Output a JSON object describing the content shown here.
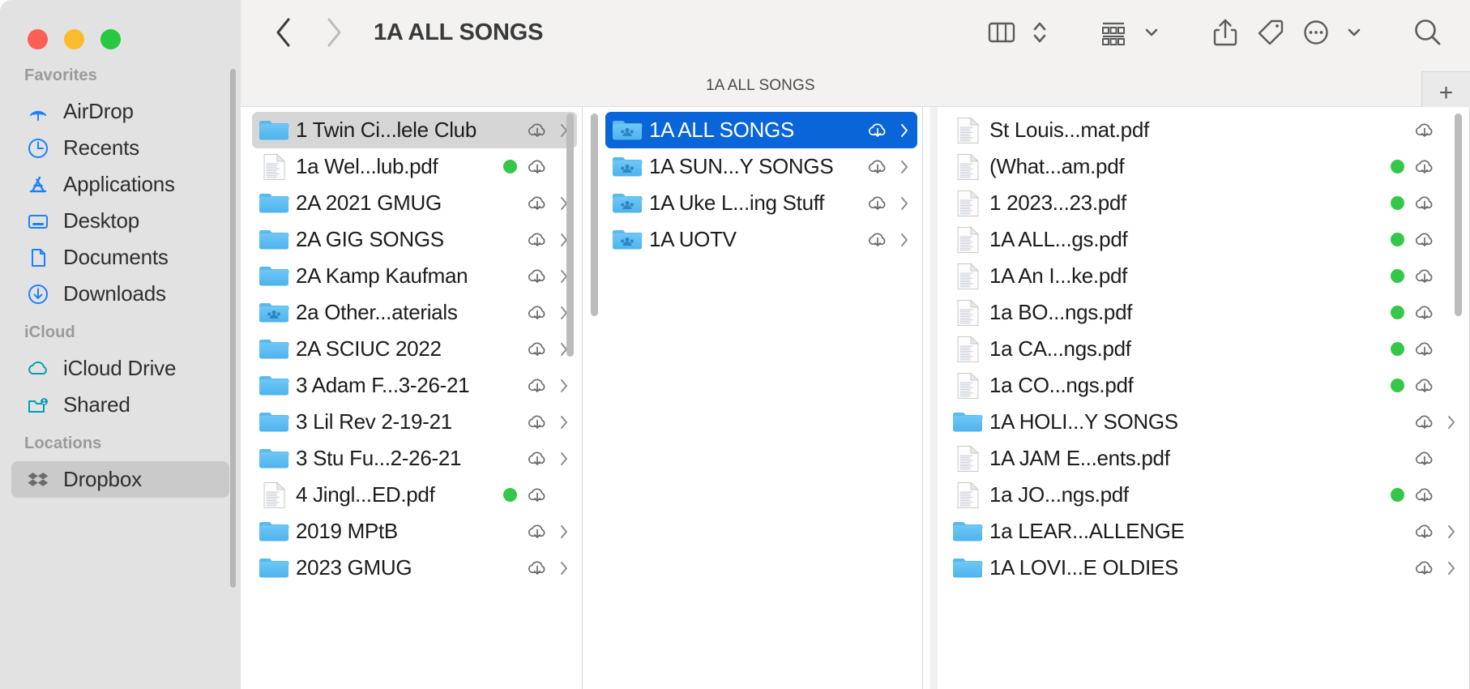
{
  "window": {
    "traffic_lights": [
      "close",
      "minimize",
      "zoom"
    ],
    "accent_blue": "#0a66d8",
    "sidebar_bg": "#e2e2e2",
    "toolbar_bg": "#f3f2f1",
    "green_tag": "#34c84a"
  },
  "sidebar": {
    "sections": [
      {
        "title": "Favorites",
        "items": [
          {
            "label": "AirDrop",
            "icon": "airdrop-icon",
            "color": "#1a80ff",
            "selected": false
          },
          {
            "label": "Recents",
            "icon": "clock-icon",
            "color": "#1a80ff",
            "selected": false
          },
          {
            "label": "Applications",
            "icon": "applications-icon",
            "color": "#1a80ff",
            "selected": false
          },
          {
            "label": "Desktop",
            "icon": "desktop-icon",
            "color": "#1a80ff",
            "selected": false
          },
          {
            "label": "Documents",
            "icon": "document-icon",
            "color": "#1a80ff",
            "selected": false
          },
          {
            "label": "Downloads",
            "icon": "download-icon",
            "color": "#1a80ff",
            "selected": false
          }
        ]
      },
      {
        "title": "iCloud",
        "items": [
          {
            "label": "iCloud Drive",
            "icon": "cloud-icon",
            "color": "#00a0b4",
            "selected": false
          },
          {
            "label": "Shared",
            "icon": "shared-folder-icon",
            "color": "#00a0b4",
            "selected": false
          }
        ]
      },
      {
        "title": "Locations",
        "items": [
          {
            "label": "Dropbox",
            "icon": "dropbox-icon",
            "color": "#6b6b6b",
            "selected": true
          }
        ]
      }
    ]
  },
  "toolbar": {
    "back_label": "Back",
    "forward_label": "Forward",
    "title": "1A ALL SONGS",
    "buttons": [
      {
        "name": "column-view-button",
        "icon": "columns-icon"
      },
      {
        "name": "view-stepper-button",
        "icon": "chevron-updown-icon"
      },
      {
        "name": "group-by-button",
        "icon": "group-items-icon"
      },
      {
        "name": "group-by-chevron",
        "icon": "chevron-down-icon"
      },
      {
        "name": "share-button",
        "icon": "share-icon"
      },
      {
        "name": "tag-button",
        "icon": "tag-icon"
      },
      {
        "name": "more-actions-button",
        "icon": "ellipsis-circle-icon"
      },
      {
        "name": "more-chevron",
        "icon": "chevron-down-icon"
      },
      {
        "name": "search-button",
        "icon": "search-icon"
      }
    ]
  },
  "pathbar": {
    "label": "1A ALL SONGS",
    "add_tab_label": "+"
  },
  "columns": [
    {
      "name": "column-1",
      "items": [
        {
          "name": "1 Twin Ci...lele Club",
          "type": "folder",
          "selected": "gray",
          "tag": false,
          "cloud": true,
          "chevron": true
        },
        {
          "name": "1a Wel...lub.pdf",
          "type": "pdf-preview",
          "selected": "none",
          "tag": true,
          "cloud": true,
          "chevron": false
        },
        {
          "name": "2A 2021 GMUG",
          "type": "folder",
          "selected": "none",
          "tag": false,
          "cloud": true,
          "chevron": true
        },
        {
          "name": "2A GIG SONGS",
          "type": "folder",
          "selected": "none",
          "tag": false,
          "cloud": true,
          "chevron": true
        },
        {
          "name": "2A Kamp Kaufman",
          "type": "folder",
          "selected": "none",
          "tag": false,
          "cloud": true,
          "chevron": true
        },
        {
          "name": "2a Other...aterials",
          "type": "shared-folder",
          "selected": "none",
          "tag": false,
          "cloud": true,
          "chevron": true
        },
        {
          "name": "2A SCIUC  2022",
          "type": "folder",
          "selected": "none",
          "tag": false,
          "cloud": true,
          "chevron": true
        },
        {
          "name": "3 Adam F...3-26-21",
          "type": "folder",
          "selected": "none",
          "tag": false,
          "cloud": true,
          "chevron": true
        },
        {
          "name": "3 Lil Rev 2-19-21",
          "type": "folder",
          "selected": "none",
          "tag": false,
          "cloud": true,
          "chevron": true
        },
        {
          "name": "3 Stu Fu...2-26-21",
          "type": "folder",
          "selected": "none",
          "tag": false,
          "cloud": true,
          "chevron": true
        },
        {
          "name": "4 Jingl...ED.pdf",
          "type": "pdf-preview",
          "selected": "none",
          "tag": true,
          "cloud": true,
          "chevron": false
        },
        {
          "name": "2019 MPtB",
          "type": "folder",
          "selected": "none",
          "tag": false,
          "cloud": true,
          "chevron": true
        },
        {
          "name": "2023 GMUG",
          "type": "folder",
          "selected": "none",
          "tag": false,
          "cloud": true,
          "chevron": true
        }
      ]
    },
    {
      "name": "column-2",
      "items": [
        {
          "name": "1A ALL SONGS",
          "type": "shared-folder",
          "selected": "blue",
          "tag": false,
          "cloud": true,
          "chevron": true
        },
        {
          "name": "1A SUN...Y SONGS",
          "type": "shared-folder",
          "selected": "none",
          "tag": false,
          "cloud": true,
          "chevron": true
        },
        {
          "name": "1A Uke L...ing Stuff",
          "type": "shared-folder",
          "selected": "none",
          "tag": false,
          "cloud": true,
          "chevron": true
        },
        {
          "name": "1A UOTV",
          "type": "shared-folder",
          "selected": "none",
          "tag": false,
          "cloud": true,
          "chevron": true
        }
      ]
    },
    {
      "name": "column-3",
      "items": [
        {
          "name": "St Louis...mat.pdf",
          "type": "pdf-preview",
          "selected": "none",
          "tag": false,
          "cloud": true,
          "chevron": false
        },
        {
          "name": "(What...am.pdf",
          "type": "pdf-preview",
          "selected": "none",
          "tag": true,
          "cloud": true,
          "chevron": false
        },
        {
          "name": "1 2023...23.pdf",
          "type": "pdf-preview",
          "selected": "none",
          "tag": true,
          "cloud": true,
          "chevron": false
        },
        {
          "name": "1A ALL...gs.pdf",
          "type": "pdf-preview",
          "selected": "none",
          "tag": true,
          "cloud": true,
          "chevron": false
        },
        {
          "name": "1A An I...ke.pdf",
          "type": "pdf-preview",
          "selected": "none",
          "tag": true,
          "cloud": true,
          "chevron": false
        },
        {
          "name": "1a BO...ngs.pdf",
          "type": "pdf-preview",
          "selected": "none",
          "tag": true,
          "cloud": true,
          "chevron": false
        },
        {
          "name": "1a CA...ngs.pdf",
          "type": "pdf-preview",
          "selected": "none",
          "tag": true,
          "cloud": true,
          "chevron": false
        },
        {
          "name": "1a CO...ngs.pdf",
          "type": "pdf-preview",
          "selected": "none",
          "tag": true,
          "cloud": true,
          "chevron": false
        },
        {
          "name": "1A HOLI...Y SONGS",
          "type": "folder",
          "selected": "none",
          "tag": false,
          "cloud": true,
          "chevron": true
        },
        {
          "name": "1A JAM E...ents.pdf",
          "type": "pdf-preview",
          "selected": "none",
          "tag": false,
          "cloud": true,
          "chevron": false
        },
        {
          "name": "1a JO...ngs.pdf",
          "type": "pdf-preview",
          "selected": "none",
          "tag": true,
          "cloud": true,
          "chevron": false
        },
        {
          "name": "1a LEAR...ALLENGE",
          "type": "folder",
          "selected": "none",
          "tag": false,
          "cloud": true,
          "chevron": true
        },
        {
          "name": "1A LOVI...E OLDIES",
          "type": "folder",
          "selected": "none",
          "tag": false,
          "cloud": true,
          "chevron": true
        }
      ]
    }
  ]
}
